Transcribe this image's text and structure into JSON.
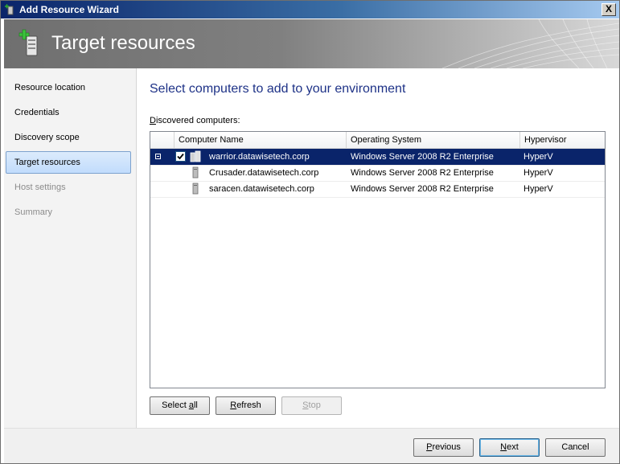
{
  "window": {
    "title": "Add Resource Wizard",
    "close_label": "X"
  },
  "banner": {
    "title": "Target resources"
  },
  "nav": {
    "items": [
      {
        "label": "Resource location",
        "state": "normal"
      },
      {
        "label": "Credentials",
        "state": "normal"
      },
      {
        "label": "Discovery scope",
        "state": "normal"
      },
      {
        "label": "Target resources",
        "state": "selected"
      },
      {
        "label": "Host settings",
        "state": "disabled"
      },
      {
        "label": "Summary",
        "state": "disabled"
      }
    ]
  },
  "main": {
    "heading": "Select computers to add to your environment",
    "list_label_mnemonic": "D",
    "list_label_rest": "iscovered computers:",
    "columns": {
      "computer_name": "Computer Name",
      "os": "Operating System",
      "hypervisor": "Hypervisor"
    },
    "rows": [
      {
        "name": "warrior.datawisetech.corp",
        "os": "Windows Server 2008 R2 Enterprise",
        "hypervisor": "HyperV",
        "selected": true,
        "checked": true
      },
      {
        "name": "Crusader.datawisetech.corp",
        "os": "Windows Server 2008 R2 Enterprise",
        "hypervisor": "HyperV",
        "selected": false
      },
      {
        "name": "saracen.datawisetech.corp",
        "os": "Windows Server 2008 R2 Enterprise",
        "hypervisor": "HyperV",
        "selected": false
      }
    ],
    "buttons": {
      "select_all_prefix": "Select ",
      "select_all_mnemonic": "a",
      "select_all_suffix": "ll",
      "refresh_mnemonic": "R",
      "refresh_rest": "efresh",
      "stop_mnemonic": "S",
      "stop_rest": "top"
    }
  },
  "footer": {
    "previous_mnemonic": "P",
    "previous_rest": "revious",
    "next_mnemonic": "N",
    "next_rest": "ext",
    "cancel_label": "Cancel"
  },
  "colors": {
    "selection": "#0a246a",
    "heading": "#1e3287"
  }
}
